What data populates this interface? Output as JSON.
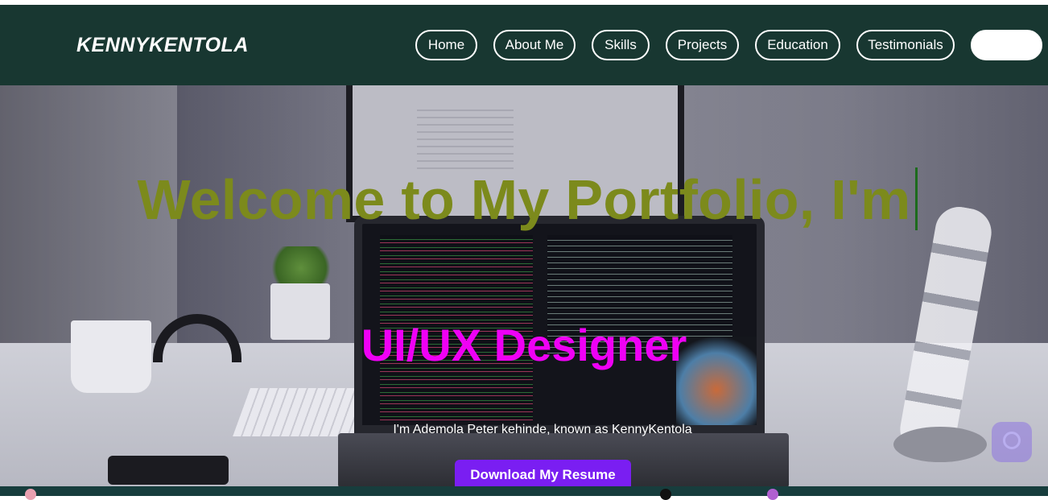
{
  "brand": {
    "name": "KENNYKENTOLA"
  },
  "nav": {
    "items": [
      {
        "label": "Home"
      },
      {
        "label": "About Me"
      },
      {
        "label": "Skills"
      },
      {
        "label": "Projects"
      },
      {
        "label": "Education"
      },
      {
        "label": "Testimonials"
      },
      {
        "label": ""
      }
    ]
  },
  "hero": {
    "title": "Welcome to My Portfolio, I'm",
    "role": "UI/UX Designer",
    "intro": "I'm Ademola Peter kehinde, known as KennyKentola",
    "resume_button": "Download My Resume"
  },
  "colors": {
    "header_bg": "#183731",
    "title": "#7c8a1c",
    "role": "#ef00f5",
    "resume_button": "#7a1ef2",
    "bottom_bar": "#173d3d"
  },
  "icons": {
    "chat": "chat-bubble-icon"
  }
}
